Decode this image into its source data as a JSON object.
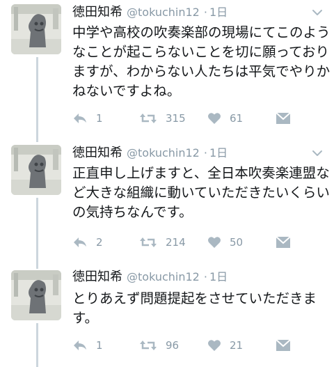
{
  "tweets": [
    {
      "name": "徳田知希",
      "handle": "@tokuchin12",
      "time": "1日",
      "text": "中学や高校の吹奏楽部の現場にてこのようなことが起こらないことを切に願っておりますが、わからない人たちは平気でやりかねないですよね。",
      "replies": "1",
      "retweets": "315",
      "likes": "61"
    },
    {
      "name": "徳田知希",
      "handle": "@tokuchin12",
      "time": "1日",
      "text": "正直申し上げますと、全日本吹奏楽連盟など大きな組織に動いていただきたいくらいの気持ちなんです。",
      "replies": "2",
      "retweets": "214",
      "likes": "50"
    },
    {
      "name": "徳田知希",
      "handle": "@tokuchin12",
      "time": "1日",
      "text": "とりあえず問題提起をさせていただきます。",
      "replies": "1",
      "retweets": "96",
      "likes": "21"
    }
  ],
  "header_separator": "·",
  "icons": {
    "reply": "reply-icon",
    "retweet": "retweet-icon",
    "like": "heart-icon",
    "dm": "direct-message-icon",
    "menu": "chevron-down-icon"
  },
  "colors": {
    "text": "#14171a",
    "secondary": "#8899a6",
    "thread_line": "#ccd6dd"
  }
}
